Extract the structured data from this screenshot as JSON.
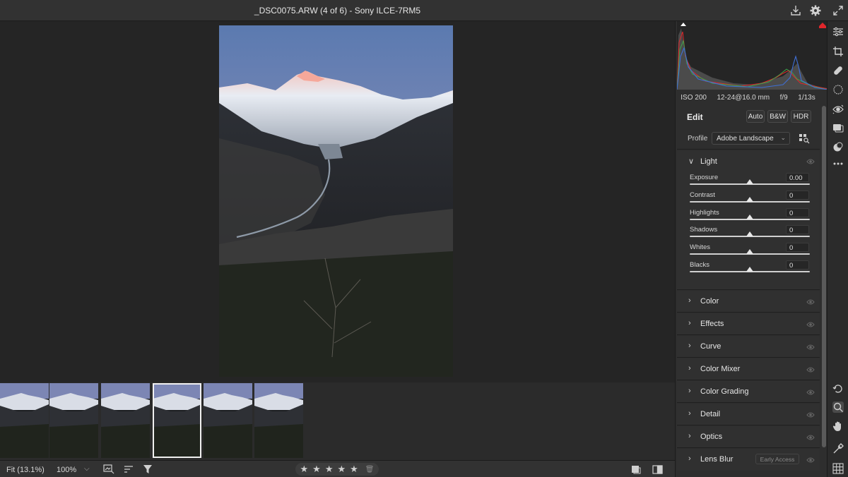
{
  "window": {
    "title": "_DSC0075.ARW (4 of 6)  -  Sony ILCE-7RM5",
    "icons": [
      "download-icon",
      "settings-icon",
      "expand-icon"
    ]
  },
  "filmstrip": {
    "count": 6,
    "selected_index": 3
  },
  "bottombar": {
    "fit_label": "Fit (13.1%)",
    "zoom_label": "100%",
    "icons": [
      "compare-view-icon",
      "sort-icon",
      "filter-icon",
      "before-after-icon",
      "split-view-icon"
    ],
    "rating_max": 5,
    "rating_value": 0
  },
  "histogram": {
    "exif": {
      "iso": "ISO 200",
      "lens": "12-24@16.0 mm",
      "aperture": "f/9",
      "shutter": "1/13s"
    }
  },
  "edit": {
    "heading": "Edit",
    "buttons": [
      "Auto",
      "B&W",
      "HDR"
    ],
    "profile_label": "Profile",
    "profile_value": "Adobe Landscape",
    "light": {
      "title": "Light",
      "sliders": [
        {
          "label": "Exposure",
          "value": "0.00",
          "position": 0.5
        },
        {
          "label": "Contrast",
          "value": "0",
          "position": 0.5
        },
        {
          "label": "Highlights",
          "value": "0",
          "position": 0.5
        },
        {
          "label": "Shadows",
          "value": "0",
          "position": 0.5
        },
        {
          "label": "Whites",
          "value": "0",
          "position": 0.5
        },
        {
          "label": "Blacks",
          "value": "0",
          "position": 0.5
        }
      ]
    },
    "sections": [
      {
        "title": "Color"
      },
      {
        "title": "Effects"
      },
      {
        "title": "Curve"
      },
      {
        "title": "Color Mixer"
      },
      {
        "title": "Color Grading"
      },
      {
        "title": "Detail"
      },
      {
        "title": "Optics"
      },
      {
        "title": "Lens Blur",
        "badge": "Early Access"
      }
    ]
  },
  "tools": [
    "edit-sliders-icon",
    "crop-icon",
    "heal-icon",
    "masking-icon",
    "red-eye-icon",
    "snapshots-icon",
    "presets-icon",
    "more-icon",
    "rotate-icon",
    "zoom-icon",
    "hand-icon",
    "sampler-icon",
    "grid-icon"
  ],
  "colors": {
    "accent_clip": "#e0262b",
    "panel_bg": "#2e2e2e",
    "canvas_bg": "#252525"
  }
}
